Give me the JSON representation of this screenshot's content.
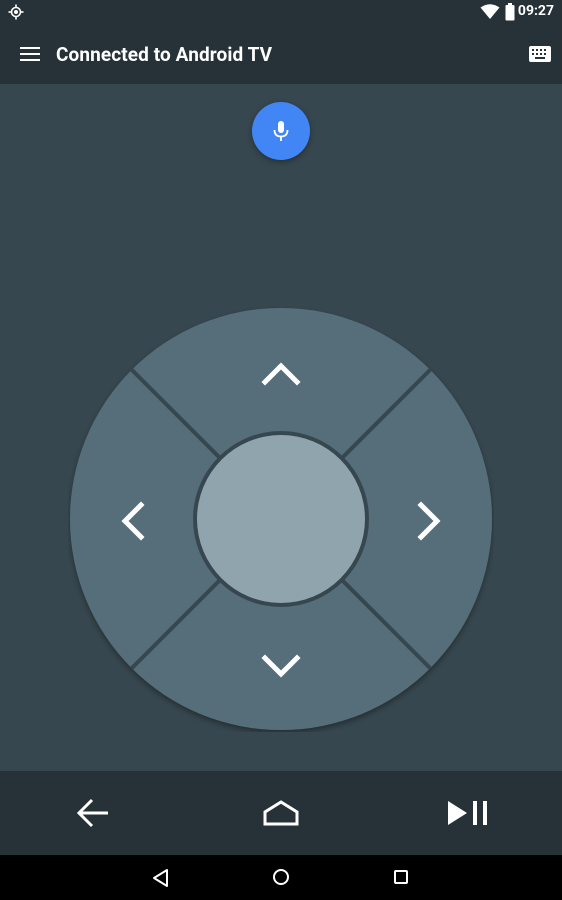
{
  "status_bar": {
    "time": "09:27",
    "icons": [
      "location-icon",
      "wifi-icon",
      "battery-icon"
    ]
  },
  "app_bar": {
    "title": "Connected to Android TV",
    "menu_icon": "hamburger-menu-icon",
    "keyboard_icon": "keyboard-icon"
  },
  "main": {
    "voice_search_icon": "microphone-icon",
    "dpad": {
      "up_icon": "chevron-up-icon",
      "down_icon": "chevron-down-icon",
      "left_icon": "chevron-left-icon",
      "right_icon": "chevron-right-icon",
      "center": "select-button"
    }
  },
  "controls": {
    "back_icon": "arrow-left-icon",
    "home_icon": "home-outline-icon",
    "play_pause_icon": "play-pause-icon"
  },
  "system_nav": {
    "back_icon": "triangle-back-icon",
    "home_icon": "circle-home-icon",
    "recents_icon": "square-recents-icon"
  },
  "colors": {
    "primary_dark": "#263238",
    "background": "#37474f",
    "dpad_outer": "#546e7a",
    "dpad_center": "#90a4ae",
    "accent": "#4285f4",
    "icon": "#ffffff"
  }
}
